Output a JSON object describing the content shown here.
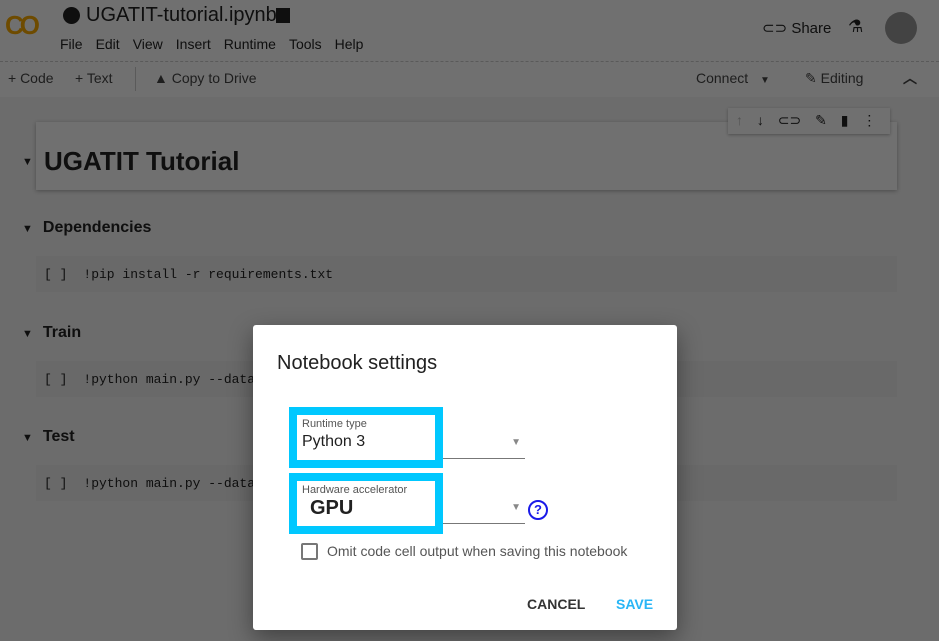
{
  "header": {
    "title": "UGATIT-tutorial.ipynb",
    "menu": [
      "File",
      "Edit",
      "View",
      "Insert",
      "Runtime",
      "Tools",
      "Help"
    ],
    "share": "Share"
  },
  "toolbar": {
    "code": "+ Code",
    "text": "+ Text",
    "copy": "Copy to Drive",
    "connect": "Connect",
    "editing": "Editing"
  },
  "notebook": {
    "title": "UGATIT Tutorial",
    "sections": [
      {
        "title": "Dependencies",
        "code": "!pip install -r requirements.txt"
      },
      {
        "title": "Train",
        "code": "!python main.py --data"
      },
      {
        "title": "Test",
        "code": "!python main.py --data"
      }
    ],
    "cell_prompt": "[ ]"
  },
  "dialog": {
    "title": "Notebook settings",
    "runtime_label": "Runtime type",
    "runtime_value": "Python 3",
    "accel_label": "Hardware accelerator",
    "accel_value": "GPU",
    "omit_label": "Omit code cell output when saving this notebook",
    "omit_checked": false,
    "cancel": "CANCEL",
    "save": "SAVE",
    "highlight_color": "#00c8ff",
    "accent": "#1a73e8"
  }
}
